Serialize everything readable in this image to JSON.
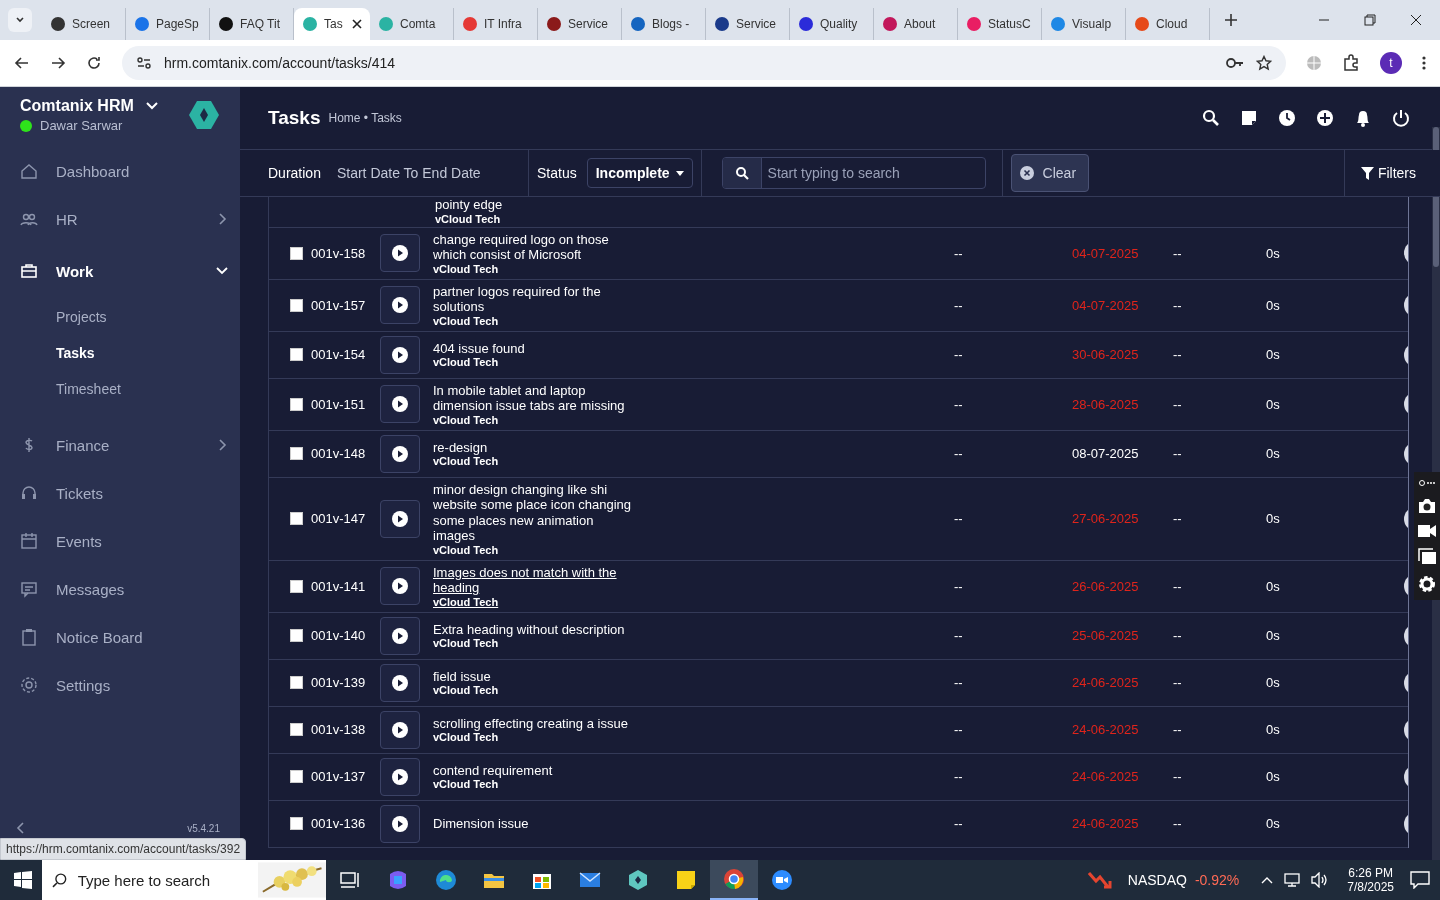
{
  "browser": {
    "tabs": [
      {
        "title": "Screen",
        "selected": false,
        "color": "#333333"
      },
      {
        "title": "PageSp",
        "selected": false,
        "color": "#1a73e8"
      },
      {
        "title": "FAQ Tit",
        "selected": false,
        "color": "#111111"
      },
      {
        "title": "Tas",
        "selected": true,
        "color": "#2bb3a3"
      },
      {
        "title": "Comta",
        "selected": false,
        "color": "#2bb3a3"
      },
      {
        "title": "IT Infra",
        "selected": false,
        "color": "#e53935"
      },
      {
        "title": "Service",
        "selected": false,
        "color": "#8b1a1a"
      },
      {
        "title": "Blogs -",
        "selected": false,
        "color": "#1565c0"
      },
      {
        "title": "Service",
        "selected": false,
        "color": "#1a3a8a"
      },
      {
        "title": "Quality",
        "selected": false,
        "color": "#2b2bd9"
      },
      {
        "title": "About",
        "selected": false,
        "color": "#c2185b"
      },
      {
        "title": "StatusC",
        "selected": false,
        "color": "#e91e63"
      },
      {
        "title": "Visualp",
        "selected": false,
        "color": "#1e88e5"
      },
      {
        "title": "Cloud",
        "selected": false,
        "color": "#e64a19"
      }
    ],
    "address": "hrm.comtanix.com/account/tasks/414",
    "profile_initial": "t"
  },
  "sidebar": {
    "brand": "Comtanix HRM",
    "user": "Dawar Sarwar",
    "online": true,
    "items": [
      {
        "label": "Dashboard",
        "kind": "link",
        "selected": false
      },
      {
        "label": "HR",
        "kind": "group",
        "selected": false,
        "expanded": false
      },
      {
        "label": "Work",
        "kind": "group",
        "selected": true,
        "expanded": true,
        "children": [
          {
            "label": "Projects",
            "selected": false
          },
          {
            "label": "Tasks",
            "selected": true
          },
          {
            "label": "Timesheet",
            "selected": false
          }
        ]
      },
      {
        "label": "Finance",
        "kind": "group",
        "selected": false,
        "expanded": false
      },
      {
        "label": "Tickets",
        "kind": "link",
        "selected": false
      },
      {
        "label": "Events",
        "kind": "link",
        "selected": false
      },
      {
        "label": "Messages",
        "kind": "link",
        "selected": false
      },
      {
        "label": "Notice Board",
        "kind": "link",
        "selected": false
      },
      {
        "label": "Settings",
        "kind": "link",
        "selected": false
      }
    ],
    "version": "v5.4.21"
  },
  "header": {
    "title": "Tasks",
    "breadcrumb": "Home • Tasks"
  },
  "filters": {
    "duration_label": "Duration",
    "duration_value": "Start Date To End Date",
    "status_label": "Status",
    "status_value": "Incomplete",
    "search_placeholder": "Start typing to search",
    "clear": "Clear",
    "filters": "Filters"
  },
  "rows": [
    {
      "title": "pointy edge",
      "company": "vCloud Tech"
    },
    {
      "id": "001v-158",
      "title": "change required logo on those which consist of Microsoft",
      "company": "vCloud Tech",
      "column_4": "--",
      "due": "04-07-2025",
      "overdue": true,
      "column_6": "--",
      "time": "0s",
      "checked": false,
      "hovered": false
    },
    {
      "id": "001v-157",
      "title": "partner logos required for the solutions",
      "company": "vCloud Tech",
      "column_4": "--",
      "due": "04-07-2025",
      "overdue": true,
      "column_6": "--",
      "time": "0s",
      "checked": false,
      "hovered": false
    },
    {
      "id": "001v-154",
      "title": "404 issue found",
      "company": "vCloud Tech",
      "column_4": "--",
      "due": "30-06-2025",
      "overdue": true,
      "column_6": "--",
      "time": "0s",
      "checked": false,
      "hovered": false
    },
    {
      "id": "001v-151",
      "title": "In mobile tablet and laptop dimension issue tabs are missing",
      "company": "vCloud Tech",
      "column_4": "--",
      "due": "28-06-2025",
      "overdue": true,
      "column_6": "--",
      "time": "0s",
      "checked": false,
      "hovered": false
    },
    {
      "id": "001v-148",
      "title": "re-design",
      "company": "vCloud Tech",
      "column_4": "--",
      "due": "08-07-2025",
      "overdue": false,
      "column_6": "--",
      "time": "0s",
      "checked": false,
      "hovered": false
    },
    {
      "id": "001v-147",
      "title": "minor design changing like shi website some place icon changing some places new animation images",
      "company": "vCloud Tech",
      "column_4": "--",
      "due": "27-06-2025",
      "overdue": true,
      "column_6": "--",
      "time": "0s",
      "checked": false,
      "hovered": false
    },
    {
      "id": "001v-141",
      "title": "Images does not match with the heading",
      "company": "vCloud Tech",
      "column_4": "--",
      "due": "26-06-2025",
      "overdue": true,
      "column_6": "--",
      "time": "0s",
      "checked": false,
      "hovered": true
    },
    {
      "id": "001v-140",
      "title": "Extra heading without description",
      "company": "vCloud Tech",
      "column_4": "--",
      "due": "25-06-2025",
      "overdue": true,
      "column_6": "--",
      "time": "0s",
      "checked": false,
      "hovered": false
    },
    {
      "id": "001v-139",
      "title": "field issue",
      "company": "vCloud Tech",
      "column_4": "--",
      "due": "24-06-2025",
      "overdue": true,
      "column_6": "--",
      "time": "0s",
      "checked": false,
      "hovered": false
    },
    {
      "id": "001v-138",
      "title": "scrolling effecting creating a issue",
      "company": "vCloud Tech",
      "column_4": "--",
      "due": "24-06-2025",
      "overdue": true,
      "column_6": "--",
      "time": "0s",
      "checked": false,
      "hovered": false
    },
    {
      "id": "001v-137",
      "title": "contend requirement",
      "company": "vCloud Tech",
      "column_4": "--",
      "due": "24-06-2025",
      "overdue": true,
      "column_6": "--",
      "time": "0s",
      "checked": false,
      "hovered": false
    },
    {
      "id": "001v-136",
      "title": "Dimension issue",
      "column_4": "--",
      "due": "24-06-2025",
      "overdue": true,
      "column_6": "--",
      "time": "0s",
      "checked": false,
      "hovered": false
    }
  ],
  "status_url": "https://hrm.comtanix.com/account/tasks/392",
  "taskbar": {
    "search_placeholder": "Type here to search",
    "apps": [
      {
        "selected": false
      },
      {
        "selected": false
      },
      {
        "selected": false
      },
      {
        "selected": false
      },
      {
        "selected": false
      },
      {
        "selected": false
      },
      {
        "selected": false
      },
      {
        "selected": false
      },
      {
        "selected": true
      },
      {
        "selected": false
      }
    ],
    "ticker": "NASDAQ",
    "change": "-0.92%",
    "time": "6:26 PM",
    "date": "7/8/2025"
  }
}
